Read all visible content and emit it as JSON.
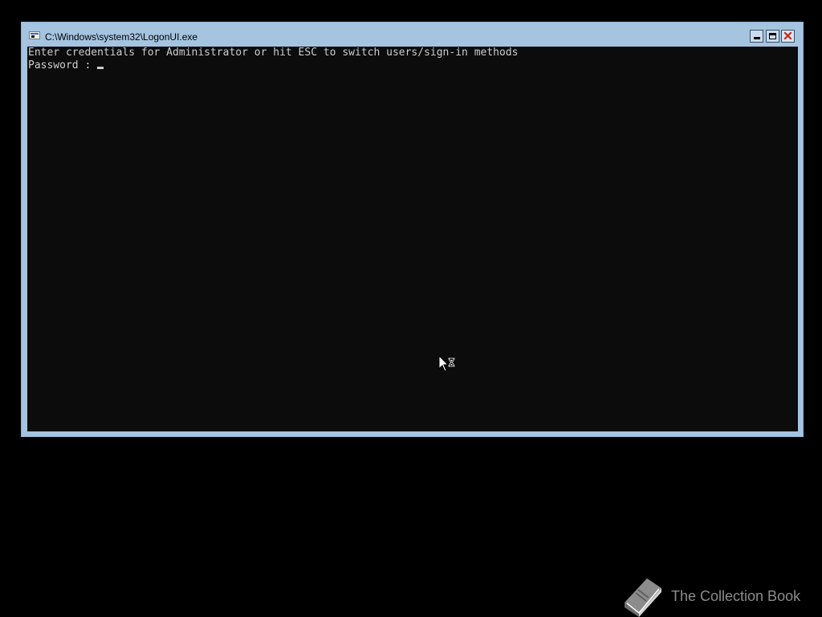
{
  "window": {
    "title": "C:\\Windows\\system32\\LogonUI.exe",
    "icon": "console-window-icon",
    "controls": {
      "minimize": "minimize-icon",
      "maximize": "maximize-icon",
      "close": "close-icon"
    }
  },
  "console": {
    "prompt_message": "Enter credentials for Administrator or hit ESC to switch users/sign-in methods",
    "password_label": "Password : ",
    "password_value": ""
  },
  "pointer": {
    "icon": "busy-pointer-icon"
  },
  "watermark": {
    "icon": "book-icon",
    "text": "The Collection Book"
  },
  "colors": {
    "desktop_background": "#000000",
    "window_frame": "#a5c4e0",
    "console_background": "#0c0c0c",
    "console_text": "#cccccc",
    "close_button_glyph": "#c42b1c",
    "watermark": "#8c8c8c"
  }
}
